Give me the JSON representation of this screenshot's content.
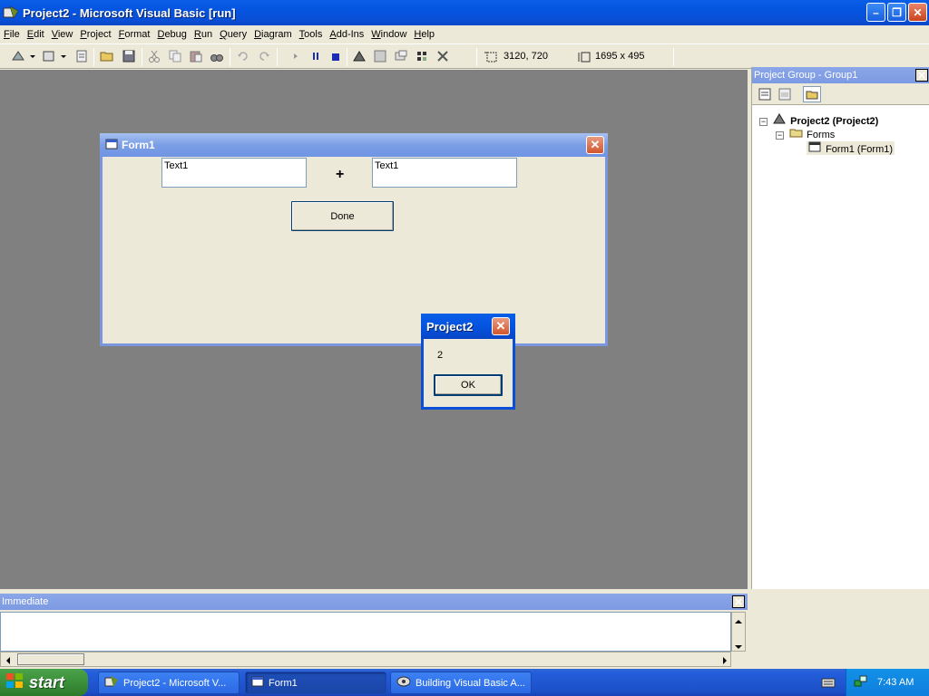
{
  "window": {
    "title": "Project2 - Microsoft Visual Basic [run]",
    "minimize": "–",
    "restore": "❐",
    "close": "✕"
  },
  "menu": [
    "File",
    "Edit",
    "View",
    "Project",
    "Format",
    "Debug",
    "Run",
    "Query",
    "Diagram",
    "Tools",
    "Add-Ins",
    "Window",
    "Help"
  ],
  "toolbar": {
    "position": "3120, 720",
    "size": "1695 x 495"
  },
  "form1": {
    "title": "Form1",
    "close": "✕",
    "text1_left": "Text1",
    "operator": "+",
    "text1_right": "Text1",
    "done": "Done"
  },
  "msgbox": {
    "title": "Project2",
    "close": "✕",
    "message": "2",
    "ok": "OK"
  },
  "project_panel": {
    "title": "Project Group - Group1",
    "close": "✕",
    "tree": {
      "project": "Project2 (Project2)",
      "folder": "Forms",
      "form": "Form1 (Form1)"
    }
  },
  "immediate": {
    "title": "Immediate",
    "close": "✕"
  },
  "taskbar": {
    "start": "start",
    "tasks": [
      "Project2 - Microsoft V...",
      "Form1",
      "Building Visual Basic A..."
    ],
    "clock": "7:43 AM"
  },
  "colors": {
    "xp_blue": "#0a4fd6",
    "mdi_gray": "#808080",
    "close_red": "#d2562d",
    "start_green": "#3c8f3a"
  }
}
